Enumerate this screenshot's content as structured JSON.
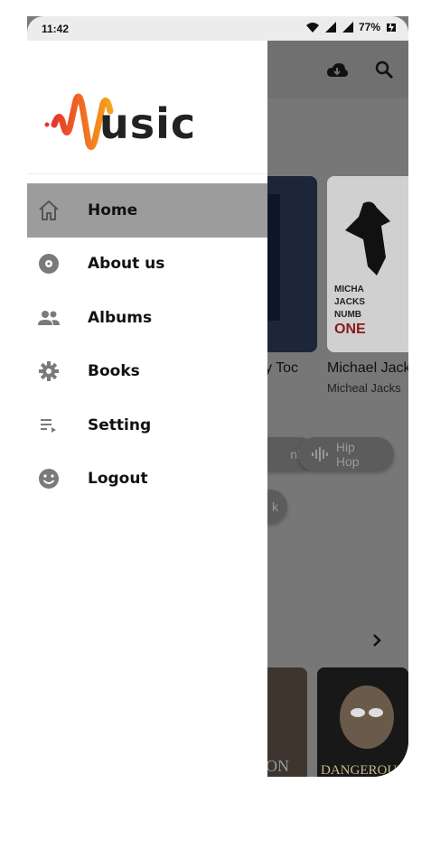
{
  "status_bar": {
    "time": "11:42",
    "battery": "77%"
  },
  "app": {
    "logo_text": "usic"
  },
  "menu": {
    "items": [
      {
        "label": "Home",
        "icon": "home-icon",
        "active": true
      },
      {
        "label": "About us",
        "icon": "disc-icon",
        "active": false
      },
      {
        "label": "Albums",
        "icon": "people-icon",
        "active": false
      },
      {
        "label": "Books",
        "icon": "gear-icon",
        "active": false
      },
      {
        "label": "Setting",
        "icon": "playlist-icon",
        "active": false
      },
      {
        "label": "Logout",
        "icon": "smiley-icon",
        "active": false
      }
    ]
  },
  "background": {
    "cards": [
      {
        "title": "ky Toc"
      },
      {
        "title": "Michael Jack",
        "subtitle": "Micheal Jacks"
      }
    ],
    "chips": [
      "nk",
      "Hip Hop",
      "k"
    ],
    "albums_art": [
      "ON",
      "DANGEROU"
    ]
  },
  "colors": {
    "accent_start": "#e8362b",
    "accent_end": "#f7a21b",
    "active_bg": "#9c9c9c",
    "scrim": "#777777"
  }
}
